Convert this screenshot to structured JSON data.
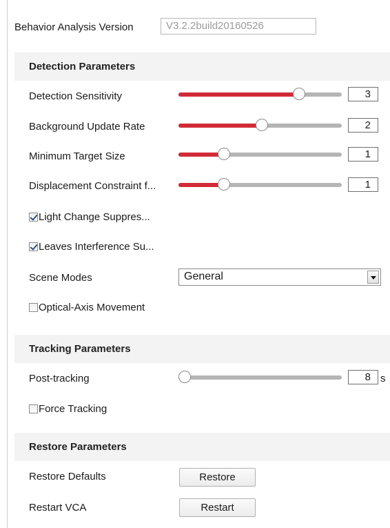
{
  "version": {
    "label": "Behavior Analysis Version",
    "value": "V3.2.2build20160526"
  },
  "detection": {
    "title": "Detection Parameters",
    "sensitivity": {
      "label": "Detection Sensitivity",
      "value": "3",
      "level": 0.74
    },
    "update_rate": {
      "label": "Background Update Rate",
      "value": "2",
      "level": 0.51
    },
    "min_target": {
      "label": "Minimum Target Size",
      "value": "1",
      "level": 0.28
    },
    "displacement": {
      "label": "Displacement Constraint f...",
      "value": "1",
      "level": 0.28
    },
    "light_change": {
      "label": "Light Change Suppres...",
      "checked": true
    },
    "leaves": {
      "label": "Leaves Interference Su...",
      "checked": true
    },
    "scene_modes": {
      "label": "Scene Modes",
      "selected": "General"
    },
    "optical_axis": {
      "label": "Optical-Axis Movement",
      "checked": false
    }
  },
  "tracking": {
    "title": "Tracking Parameters",
    "post_tracking": {
      "label": "Post-tracking",
      "value": "8",
      "unit": "s",
      "level": 0.04
    },
    "force_tracking": {
      "label": "Force Tracking",
      "checked": false
    }
  },
  "restore": {
    "title": "Restore Parameters",
    "defaults": {
      "label": "Restore Defaults",
      "button": "Restore"
    },
    "restart": {
      "label": "Restart VCA",
      "button": "Restart"
    }
  },
  "colors": {
    "slider_fill": "#d12b37",
    "slider_track": "#b5b5b5",
    "section_bg": "#f3f3f3"
  }
}
